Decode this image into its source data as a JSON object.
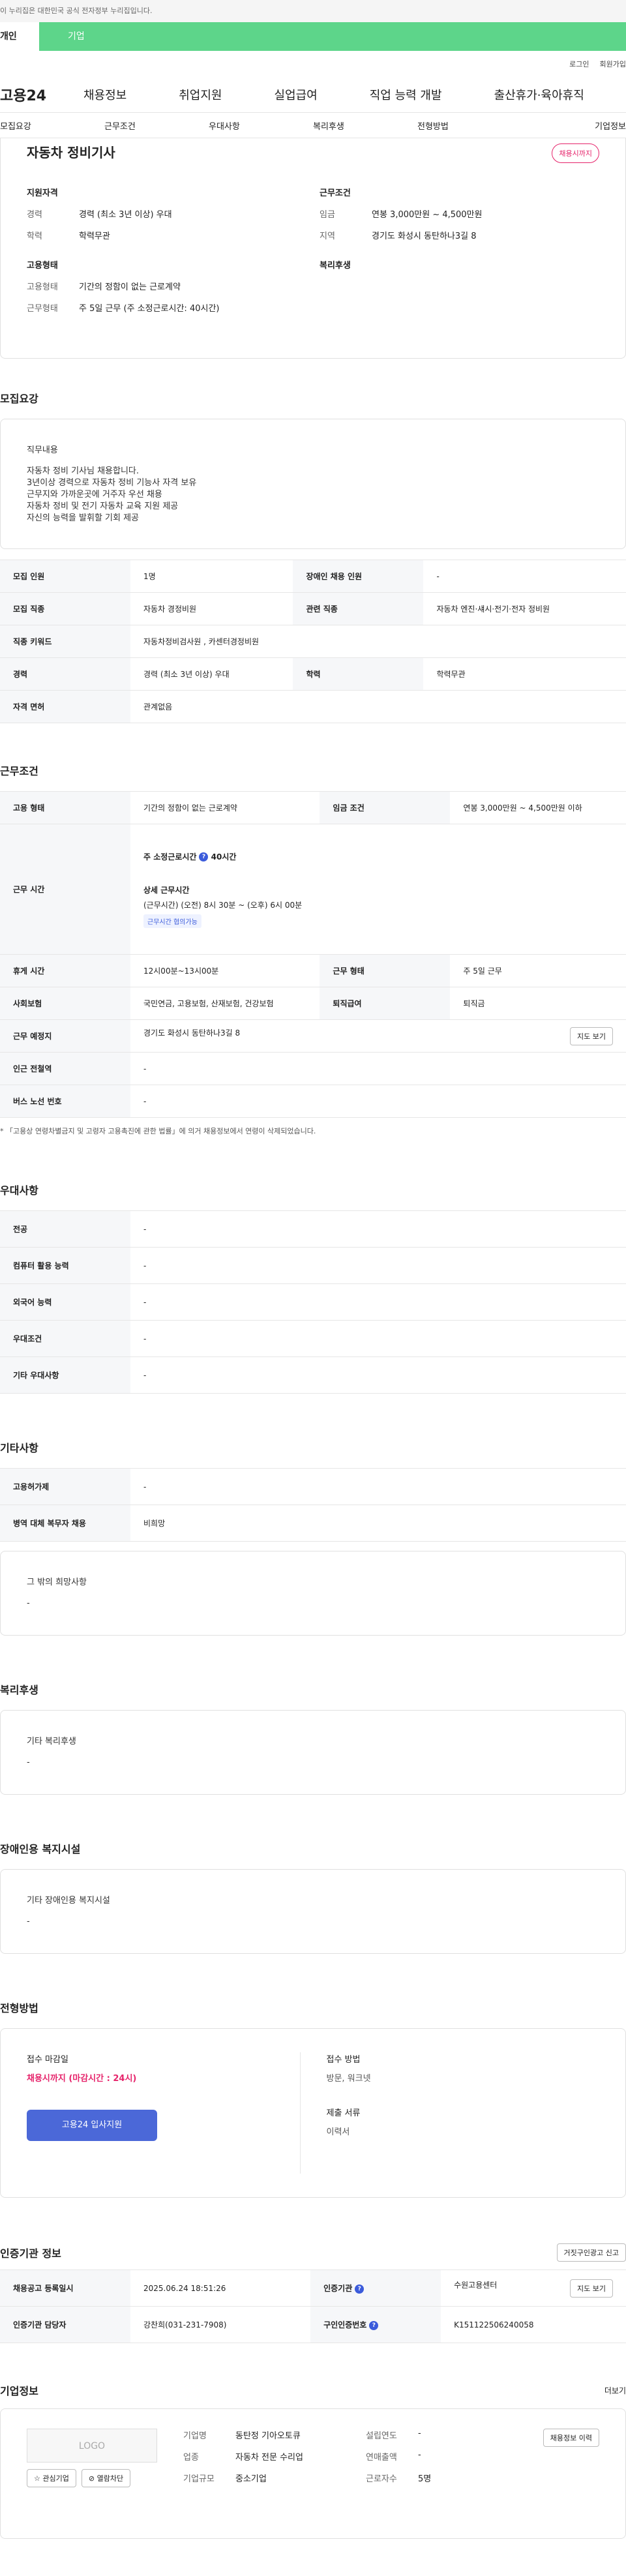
{
  "top_notice": "이 누리집은 대한민국 공식 전자정부 누리집입니다.",
  "user_tabs": [
    "개인",
    "기업"
  ],
  "util": [
    "로그인",
    "회원가입"
  ],
  "gnb": {
    "logo": "고용24",
    "items": [
      "채용정보",
      "취업지원",
      "실업급여",
      "직업 능력 개발",
      "출산휴가·육아휴직"
    ]
  },
  "subnav": [
    "모집요강",
    "근무조건",
    "우대사항",
    "복리후생",
    "전형방법",
    "기업정보"
  ],
  "summary": {
    "title": "자동차 정비기사",
    "badge": "채용시까지",
    "qual_title": "지원자격",
    "qual": [
      [
        "경력",
        "경력 (최소 3년 이상) 우대"
      ],
      [
        "학력",
        "학력무관"
      ]
    ],
    "cond_title": "근무조건",
    "cond": [
      [
        "임금",
        "연봉 3,000만원 ~ 4,500만원"
      ],
      [
        "지역",
        "경기도 화성시 동탄하나3길 8"
      ]
    ],
    "emp_title": "고용형태",
    "emp": [
      [
        "고용형태",
        "기간의 정함이 없는 근로계약"
      ],
      [
        "근무형태",
        "주 5일 근무 (주 소정근로시간: 40시간)"
      ]
    ],
    "welfare_title": "복리후생"
  },
  "recruit": {
    "title": "모집요강",
    "duty_title": "직무내용",
    "duty_lines": [
      "자동차 정비 기사님 채용합니다.",
      "3년이상 경력으로 자동차 정비 기능사 자격 보유",
      "근무지와 가까운곳에 거주자 우선 채용",
      "자동차 정비 및 전기 자동차 교육 지원 제공",
      "자신의 능력을 발휘할 기회 제공"
    ],
    "rows": [
      [
        "모집 인원",
        "1명",
        "장애인 채용 인원",
        "-"
      ],
      [
        "모집 직종",
        "자동차 경정비원",
        "관련 직종",
        "자동차 엔진·섀시·전기·전자 정비원"
      ],
      [
        "직종 키워드",
        "자동차정비검사원 , 카센터경정비원",
        "",
        ""
      ],
      [
        "경력",
        "경력 (최소 3년 이상) 우대",
        "학력",
        "학력무관"
      ],
      [
        "자격 면허",
        "관계없음",
        "",
        ""
      ]
    ]
  },
  "work": {
    "title": "근무조건",
    "emp_type_k": "고용 형태",
    "emp_type_v": "기간의 정함이 없는 근로계약",
    "wage_k": "임금 조건",
    "wage_v": "연봉 3,000만원 ~ 4,500만원 이하",
    "hours_k": "근무 시간",
    "hours_week": "주 소정근로시간",
    "hours_week_v": "40시간",
    "hours_detail_t": "상세 근무시간",
    "hours_detail": "(근무시간) (오전) 8시 30분 ~ (오후) 6시 00분",
    "flex": "근무시간 협의가능",
    "rows": [
      [
        "휴게 시간",
        "12시00분~13시00분",
        "근무 형태",
        "주 5일 근무"
      ],
      [
        "사회보험",
        "국민연금, 고용보험, 산재보험, 건강보험",
        "퇴직급여",
        "퇴직금"
      ]
    ],
    "place_k": "근무 예정지",
    "place_v": "경기도 화성시 동탄하나3길 8",
    "map_btn": "지도 보기",
    "subway_k": "인근 전철역",
    "subway_v": "-",
    "bus_k": "버스 노선 번호",
    "bus_v": "-",
    "note": "* 「고용상 연령차별금지 및 고령자 고용촉진에 관한 법률」에 의거 채용정보에서 연령이 삭제되었습니다."
  },
  "pref": {
    "title": "우대사항",
    "rows": [
      [
        "전공",
        "-"
      ],
      [
        "컴퓨터 활용 능력",
        "-"
      ],
      [
        "외국어 능력",
        "-"
      ],
      [
        "우대조건",
        "-"
      ],
      [
        "기타 우대사항",
        "-"
      ]
    ]
  },
  "etc": {
    "title": "기타사항",
    "rows": [
      [
        "고용허가제",
        "-"
      ],
      [
        "병역 대체 복무자 채용",
        "비희망"
      ]
    ],
    "other_t": "그 밖의 희망사항",
    "other_v": "-"
  },
  "welfare": {
    "title": "복리후생",
    "sub": "기타 복리후생",
    "v": "-"
  },
  "disabled": {
    "title": "장애인용 복지시설",
    "sub": "기타 장애인용 복지시설",
    "v": "-"
  },
  "selection": {
    "title": "전형방법",
    "deadline_t": "접수 마감일",
    "deadline_v": "채용시까지 (마감시간 : 24시)",
    "apply_btn": "고용24 입사지원",
    "method_t": "접수 방법",
    "method_v": "방문, 워크넷",
    "docs_t": "제출 서류",
    "docs_v": "이력서"
  },
  "cert": {
    "title": "인증기관 정보",
    "report_btn": "거짓구인광고 신고",
    "rows": [
      [
        "채용공고 등록일시",
        "2025.06.24 18:51:26",
        "인증기관",
        "수원고용센터"
      ],
      [
        "인증기관 담당자",
        "강찬희(031-231-7908)",
        "구인인증번호",
        "K151122506240058"
      ]
    ],
    "map_btn": "지도 보기"
  },
  "company": {
    "title": "기업정보",
    "more": "더보기",
    "logo": "LOGO",
    "interest": "관심기업",
    "block": "열람차단",
    "fields": [
      [
        "기업명",
        "동탄정 기아오토큐"
      ],
      [
        "업종",
        "자동차 전문 수리업"
      ],
      [
        "기업규모",
        "중소기업"
      ]
    ],
    "fields2": [
      [
        "설립연도",
        "-"
      ],
      [
        "연매출액",
        "-"
      ],
      [
        "근로자수",
        "5명"
      ]
    ],
    "hist_btn": "채용정보 이력"
  }
}
